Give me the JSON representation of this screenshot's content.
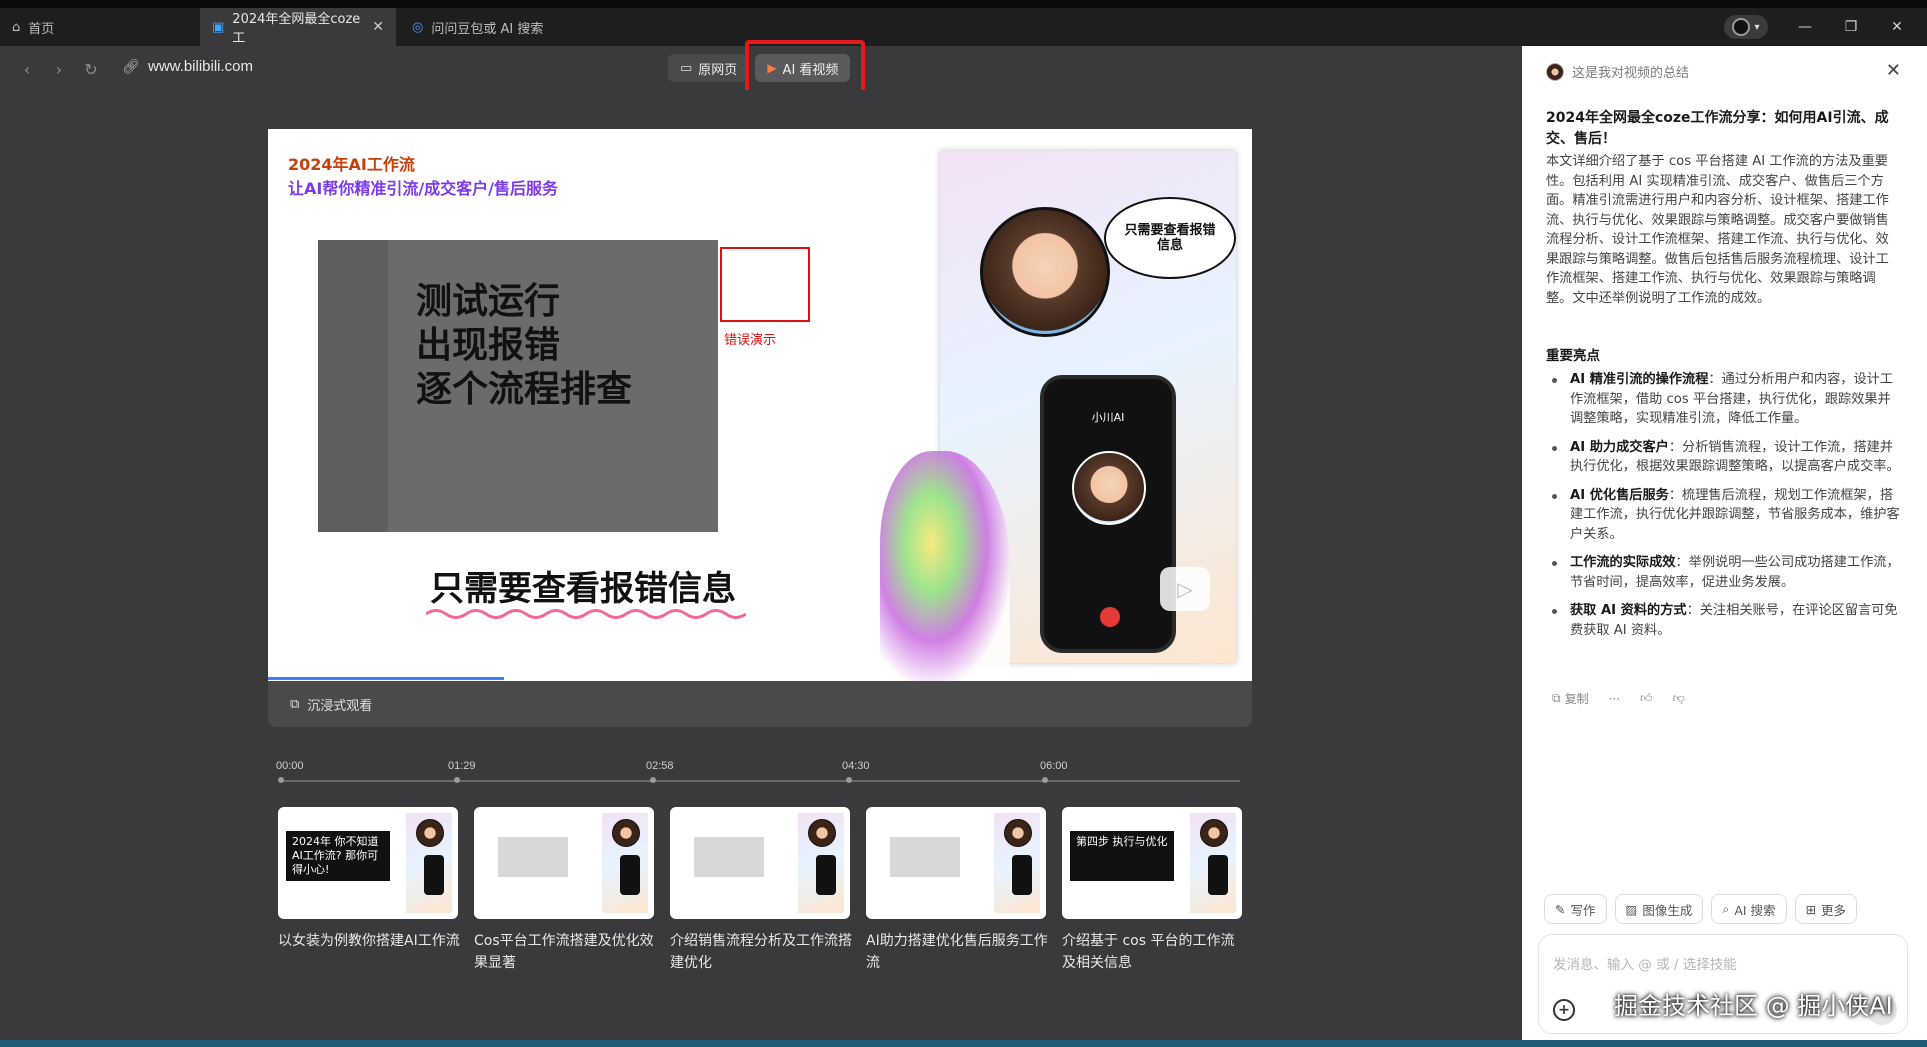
{
  "tabs": [
    {
      "label": "首页",
      "icon": "home-icon"
    },
    {
      "label": "2024年全网最全coze工",
      "icon": "bilibili-icon"
    },
    {
      "label": "问问豆包或 AI 搜索",
      "icon": "search-ai-icon"
    }
  ],
  "address": {
    "url": "www.bilibili.com"
  },
  "view_toggle": {
    "original": "原网页",
    "ai_watch": "AI 看视频"
  },
  "video": {
    "title_line1": "2024年AI工作流",
    "title_line2": "让AI帮你精准引流/成交客户/售后服务",
    "big_lines": [
      "测试运行",
      "出现报错",
      "逐个流程排查"
    ],
    "error_label": "错误演示",
    "bottom_text": "只需要查看报错信息",
    "bubble_text": "只需要查看报错信息",
    "phone_name": "小川AI",
    "progress_fraction": 0.24,
    "immerse_label": "沉浸式观看"
  },
  "timeline": {
    "marks": [
      "00:00",
      "01:29",
      "02:58",
      "04:30",
      "06:00"
    ]
  },
  "chapters": [
    {
      "caption": "以女装为例教你搭建AI工作流",
      "thumb_text": "2024年 你不知道AI工作流? 那你可得小心!"
    },
    {
      "caption": "Cos平台工作流搭建及优化效果显著",
      "thumb_text": ""
    },
    {
      "caption": "介绍销售流程分析及工作流搭建优化",
      "thumb_text": ""
    },
    {
      "caption": "AI助力搭建优化售后服务工作流",
      "thumb_text": ""
    },
    {
      "caption": "介绍基于 cos 平台的工作流及相关信息",
      "thumb_text": "第四步 执行与优化"
    }
  ],
  "summary": {
    "header": "这是我对视频的总结",
    "title": "2024年全网最全coze工作流分享：如何用AI引流、成交、售后！",
    "body": "本文详细介绍了基于 cos 平台搭建 AI 工作流的方法及重要性。包括利用 AI 实现精准引流、成交客户、做售后三个方面。精准引流需进行用户和内容分析、设计框架、搭建工作流、执行与优化、效果跟踪与策略调整。成交客户要做销售流程分析、设计工作流框架、搭建工作流、执行与优化、效果跟踪与策略调整。做售后包括售后服务流程梳理、设计工作流框架、搭建工作流、执行与优化、效果跟踪与策略调整。文中还举例说明了工作流的成效。",
    "section_title": "重要亮点",
    "highlights": [
      {
        "bold": "AI 精准引流的操作流程",
        "text": "：通过分析用户和内容，设计工作流框架，借助 cos 平台搭建，执行优化，跟踪效果并调整策略，实现精准引流，降低工作量。"
      },
      {
        "bold": "AI 助力成交客户",
        "text": "：分析销售流程，设计工作流，搭建并执行优化，根据效果跟踪调整策略，以提高客户成交率。"
      },
      {
        "bold": "AI 优化售后服务",
        "text": "：梳理售后流程，规划工作流框架，搭建工作流，执行优化并跟踪调整，节省服务成本，维护客户关系。"
      },
      {
        "bold": "工作流的实际成效",
        "text": "：举例说明一些公司成功搭建工作流，节省时间，提高效率，促进业务发展。"
      },
      {
        "bold": "获取 AI 资料的方式",
        "text": "：关注相关账号，在评论区留言可免费获取 AI 资料。"
      }
    ],
    "copy_label": "复制",
    "more_label": "···"
  },
  "chips": [
    "写作",
    "图像生成",
    "AI 搜索",
    "更多"
  ],
  "input": {
    "placeholder": "发消息、输入 @ 或 / 选择技能"
  },
  "watermark": "掘金技术社区 @ 掘小侠AI"
}
